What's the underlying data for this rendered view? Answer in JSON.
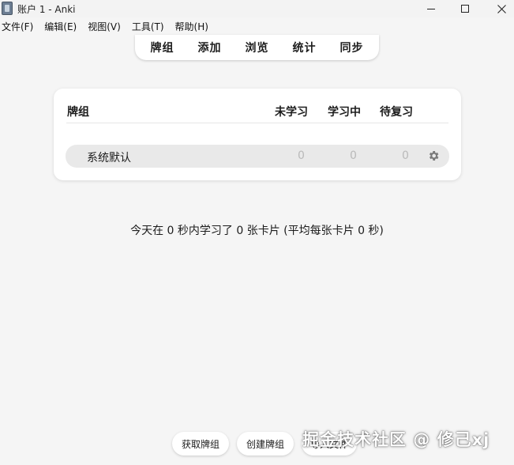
{
  "window": {
    "title": "账户 1 - Anki",
    "icon": "anki-app-icon",
    "controls": [
      "minimize-icon",
      "maximize-icon",
      "close-icon"
    ]
  },
  "menu": {
    "items": [
      "文件(F)",
      "编辑(E)",
      "视图(V)",
      "工具(T)",
      "帮助(H)"
    ]
  },
  "toolbar": {
    "links": [
      "牌组",
      "添加",
      "浏览",
      "统计",
      "同步"
    ]
  },
  "deck_table": {
    "headers": {
      "deck": "牌组",
      "new": "未学习",
      "learning": "学习中",
      "due": "待复习"
    },
    "rows": [
      {
        "name": "系统默认",
        "new": "0",
        "learning": "0",
        "due": "0",
        "options_icon": "gear-icon"
      }
    ]
  },
  "stats": {
    "text": "今天在 0 秒内学习了 0 张卡片  (平均每张卡片 0 秒)"
  },
  "bottom_buttons": {
    "get_shared": "获取牌组",
    "create_deck": "创建牌组",
    "import_file": "导入文件"
  },
  "watermark": {
    "text": "掘金技术社区 @ 修己xj"
  },
  "colors": {
    "background": "#f5f5f5",
    "card": "#ffffff",
    "row_highlight": "#e9e9e9",
    "muted_count": "#b9b9b9"
  }
}
